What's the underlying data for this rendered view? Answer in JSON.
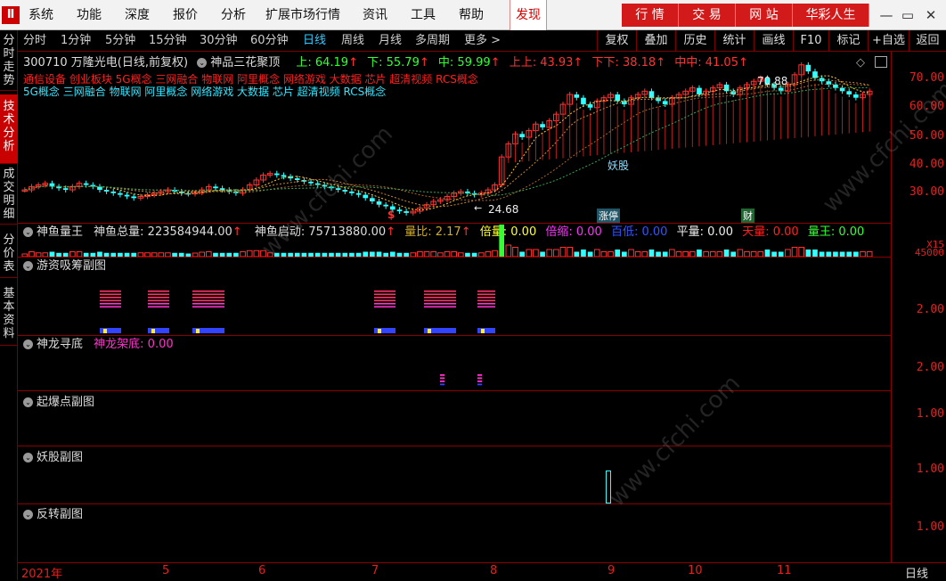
{
  "menu": {
    "items": [
      "系统",
      "功能",
      "深度",
      "报价",
      "分析",
      "扩展市场行情",
      "资讯",
      "工具",
      "帮助"
    ],
    "discover": "发现",
    "right_buttons": [
      "行 情",
      "交 易",
      "网 站",
      "华彩人生"
    ]
  },
  "side_tabs": [
    "分时走势",
    "技术分析",
    "成交明细",
    "分价表",
    "基本资料"
  ],
  "periods": [
    "分时",
    "1分钟",
    "5分钟",
    "15分钟",
    "30分钟",
    "60分钟",
    "日线",
    "周线",
    "月线",
    "多周期",
    "更多 >"
  ],
  "active_period": "日线",
  "tools": [
    "复权",
    "叠加",
    "历史",
    "统计",
    "画线",
    "F10",
    "标记",
    "+自选",
    "返回"
  ],
  "main_chart": {
    "stock": "300710 万隆光电(日线,前复权)",
    "indicator": "神品三花聚顶",
    "up_label": "上: 64.19",
    "down_label": "下: 55.79",
    "mid_label": "中: 59.99",
    "upup_label": "上上: 43.93",
    "downdown_label": "下下: 38.18",
    "midmid_label": "中中: 41.05",
    "concepts_red": "通信设备 创业板块 5G概念 三网融合 物联网 阿里概念 网络游戏 大数据 芯片 超清视频 RCS概念",
    "concepts_cyan": "5G概念 三网融合 物联网 阿里概念 网络游戏 大数据 芯片 超清视频 RCS概念",
    "high_marker": "70.88",
    "low_marker": "24.68",
    "tag_dollar": "$",
    "tag_zhangting": "涨停",
    "tag_yaogu": "妖股",
    "tag_liangcai": "财",
    "tag_laobang": "榜",
    "y_labels": [
      "70.00",
      "60.00",
      "50.00",
      "40.00",
      "30.00"
    ],
    "candles_before": [
      32,
      33,
      33.5,
      34,
      33,
      32.5,
      32,
      33,
      34,
      33.5,
      33,
      32,
      31.5,
      31,
      30.5,
      30,
      29.5,
      30,
      30.5,
      31,
      31.5,
      32,
      31.5,
      31,
      30.8,
      31.2,
      32,
      33,
      32.5,
      32,
      31.5,
      31,
      32,
      33.5,
      35,
      36.5,
      37,
      36.5,
      36,
      35.5,
      35,
      34.5,
      34,
      33.5,
      33,
      32.5,
      32,
      31.5,
      31,
      30.5,
      29.5,
      28.5,
      27.5,
      27,
      26,
      25.5,
      25,
      25.5,
      26.5,
      27.5,
      28.5,
      29,
      30,
      31,
      31.5,
      31,
      30.5,
      31,
      32,
      33.5
    ],
    "candles_after": [
      42,
      46,
      49,
      48,
      50,
      52,
      51,
      53,
      55,
      58,
      61,
      60,
      58,
      57,
      59,
      60,
      61,
      59,
      58,
      60,
      61,
      62,
      60,
      59,
      58,
      60,
      61,
      62,
      63,
      61,
      62,
      63,
      64,
      62,
      61,
      63,
      64,
      65,
      66,
      64,
      63,
      62,
      64,
      67,
      70,
      68,
      66,
      65,
      64,
      63,
      62,
      61,
      60,
      61,
      62
    ]
  },
  "vol_panel": {
    "title": "神鱼量王",
    "total": "神鱼总量: 223584944.00",
    "start": "神鱼启动: 75713880.00",
    "ratio": "量比: 2.17",
    "beiliang": "倍量: 0.00",
    "beisuo": "倍缩: 0.00",
    "baidi": "百低: 0.00",
    "pingliang": "平量: 0.00",
    "tianliang": "天量: 0.00",
    "liangwang": "量王: 0.00",
    "y_label": "45000",
    "unit_label": "X15"
  },
  "panels": [
    {
      "title": "游资吸筹副图",
      "y": "2.00"
    },
    {
      "title": "神龙寻底",
      "sub": "神龙架底: 0.00",
      "y": "2.00"
    },
    {
      "title": "起爆点副图",
      "y": "1.00"
    },
    {
      "title": "妖股副图",
      "y": "1.00"
    },
    {
      "title": "反转副图",
      "y": "1.00"
    }
  ],
  "x_axis": [
    "2021年",
    "5",
    "6",
    "7",
    "8",
    "9",
    "10",
    "11"
  ],
  "period_label": "日线",
  "colors": {
    "up": "#ff3333",
    "down": "#33ffff",
    "ma": "#ffcc33",
    "grid": "#8a0000"
  }
}
